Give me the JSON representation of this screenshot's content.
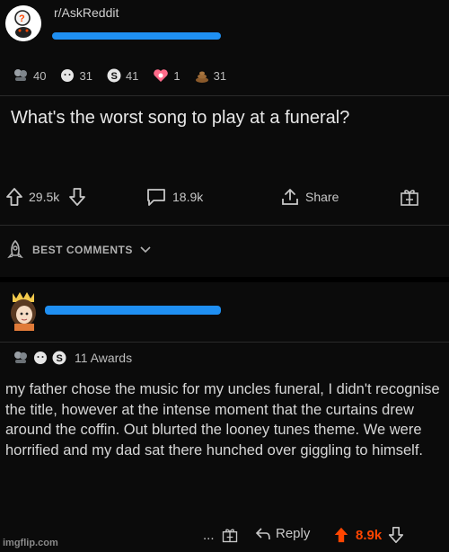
{
  "post": {
    "subreddit": "r/AskReddit",
    "awards": [
      {
        "icon": "silver-award-icon",
        "count": "40"
      },
      {
        "icon": "wholesome-award-icon",
        "count": "31"
      },
      {
        "icon": "s-award-icon",
        "count": "41"
      },
      {
        "icon": "heart-award-icon",
        "count": "1"
      },
      {
        "icon": "poop-award-icon",
        "count": "31"
      }
    ],
    "title": "What's the worst song to play at a funeral?",
    "upvotes": "29.5k",
    "comments": "18.9k",
    "share_label": "Share"
  },
  "sort": {
    "label": "BEST COMMENTS"
  },
  "comment": {
    "awards_label": "11 Awards",
    "body": "my father chose the music for my uncles funeral, I didn't recognise the title, however at the intense moment that the curtains drew around the coffin. Out blurted the looney tunes theme. We were horrified and my dad sat there hunched over giggling to himself.",
    "reply_label": "Reply",
    "score": "8.9k",
    "more_label": "..."
  },
  "watermark": "imgflip.com",
  "colors": {
    "redaction": "#1f8ff2",
    "upvote_active": "#ff4500",
    "score_active": "#ff4500"
  }
}
